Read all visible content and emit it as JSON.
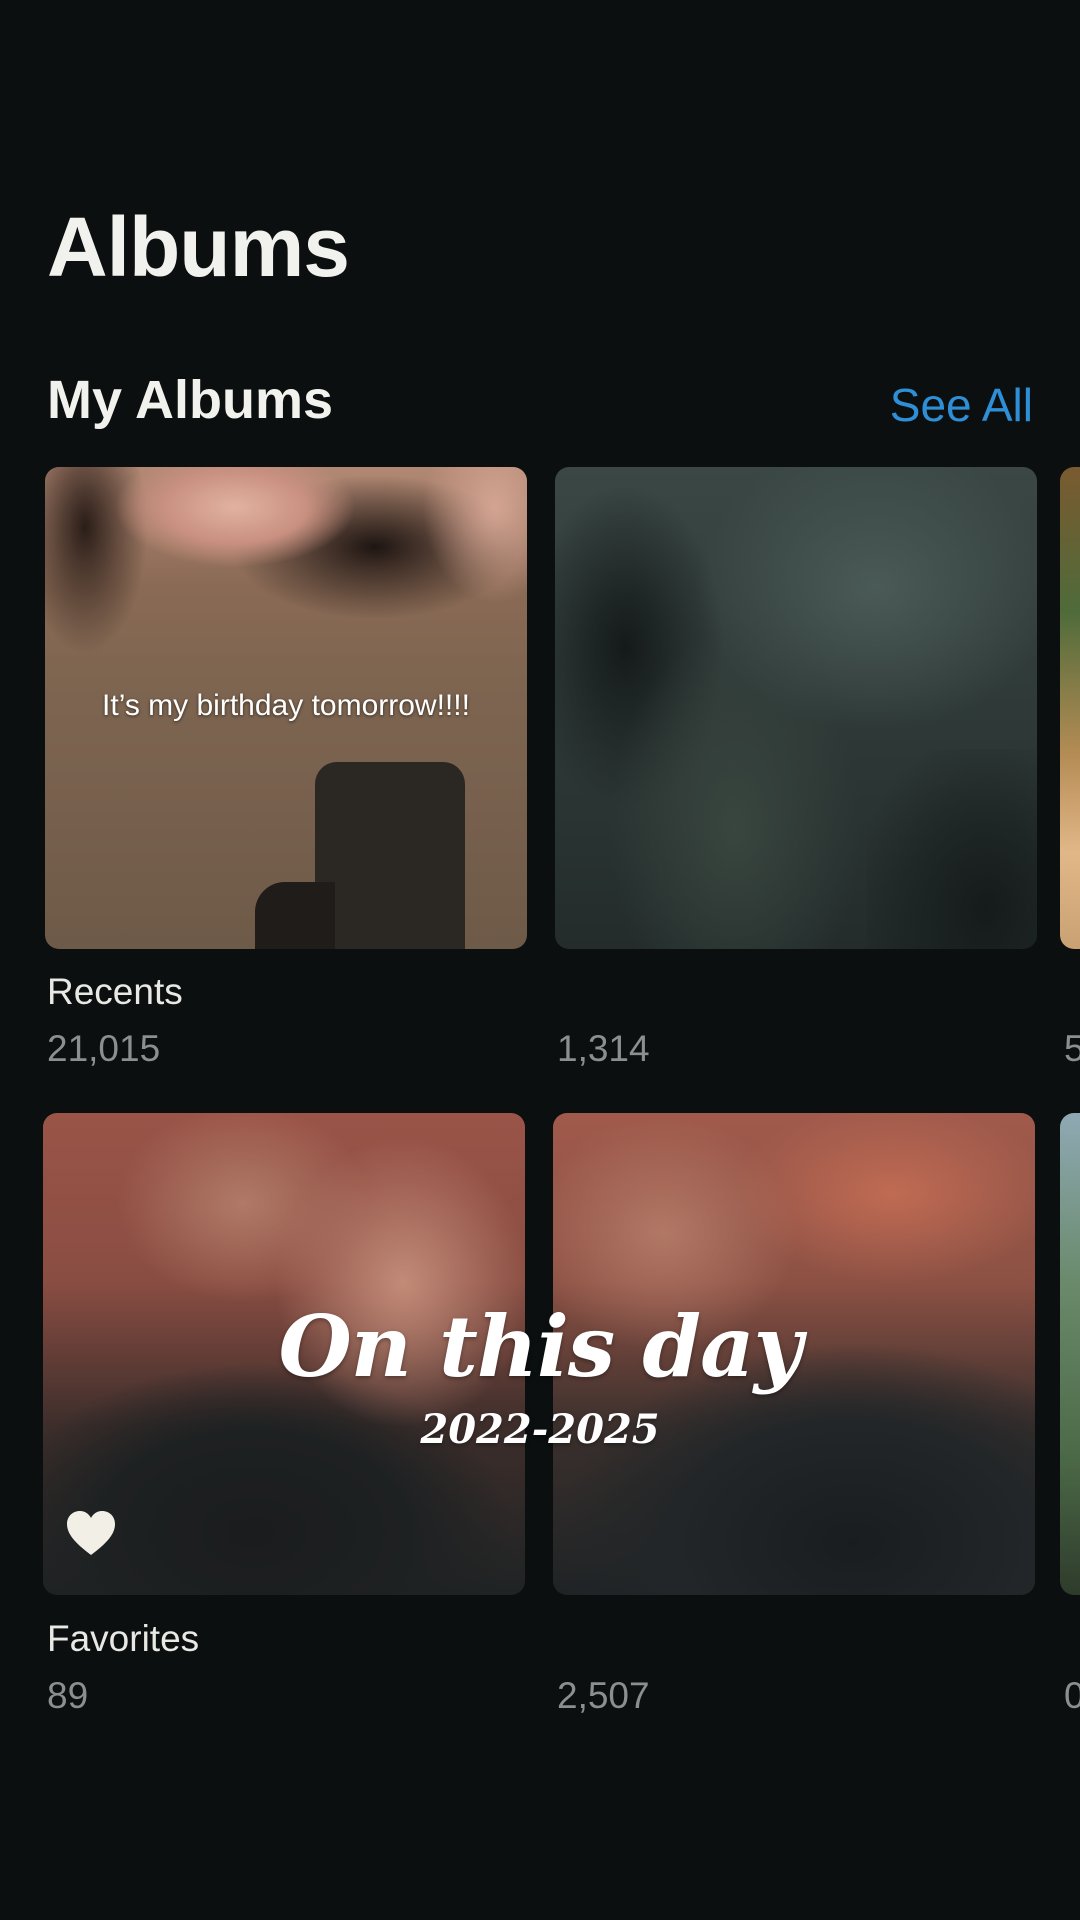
{
  "header": {
    "title": "Albums"
  },
  "section": {
    "title": "My Albums",
    "see_all_label": "See All"
  },
  "albums": [
    {
      "name": "Recents",
      "count": "21,015",
      "caption": "It’s my birthday tomorrow!!!!"
    },
    {
      "name": "",
      "count": "1,314"
    },
    {
      "name": "",
      "count": "5"
    },
    {
      "name": "Favorites",
      "count": "89"
    },
    {
      "name": "",
      "count": "2,507"
    },
    {
      "name": "",
      "count": "0"
    }
  ],
  "overlay": {
    "title": "On this day",
    "subtitle": "2022-2025"
  },
  "icons": {
    "favorite": "heart-icon"
  },
  "colors": {
    "background": "#0b0f0f",
    "accent": "#2f8fd6"
  }
}
